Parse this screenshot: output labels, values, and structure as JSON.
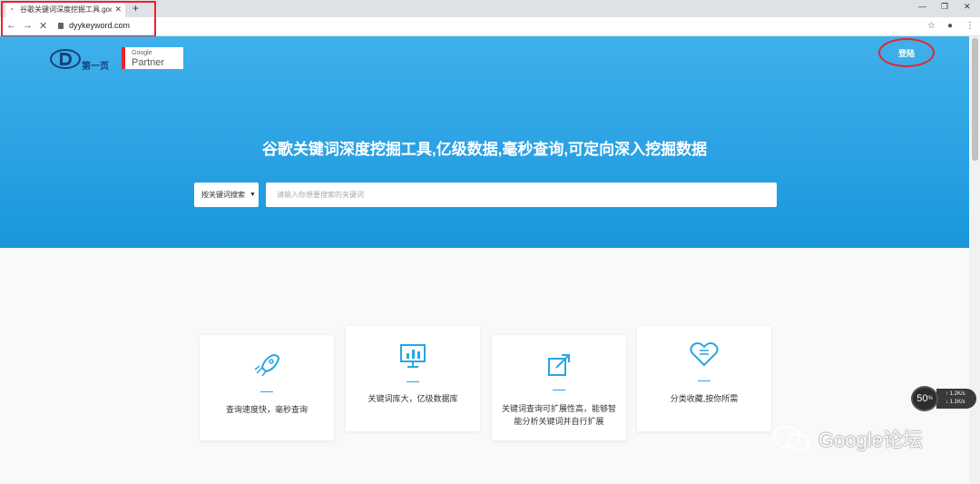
{
  "browser": {
    "tab_title": "谷歌关键词深度挖掘工具.google",
    "new_tab": "+",
    "url": "dyykeyword.com",
    "window_controls": [
      "—",
      "❐",
      "✕"
    ]
  },
  "header": {
    "logo_text": "第一页",
    "partner_small": "Google",
    "partner_big": "Partner",
    "login_label": "登陆"
  },
  "hero": {
    "headline": "谷歌关键词深度挖掘工具,亿级数据,毫秒查询,可定向深入挖掘数据",
    "search_type": "按关键词搜索",
    "search_placeholder": "请输入你想要搜索的关键词"
  },
  "features": [
    {
      "icon": "rocket-icon",
      "text": "查询速度快，毫秒查询"
    },
    {
      "icon": "chart-monitor-icon",
      "text": "关键词库大，亿级数据库"
    },
    {
      "icon": "expand-arrow-icon",
      "text": "关键词查询可扩展性高，能够智能分析关键词并自行扩展"
    },
    {
      "icon": "heart-list-icon",
      "text": "分类收藏,按你所需"
    }
  ],
  "speed_widget": {
    "value": "50",
    "unit": "%",
    "up": "1.2",
    "down": "1.1",
    "rate_unit": "K/s"
  },
  "watermark": "Google论坛",
  "colors": {
    "accent": "#1a96dd",
    "highlight": "#e8242c",
    "icon": "#28a6e6"
  }
}
